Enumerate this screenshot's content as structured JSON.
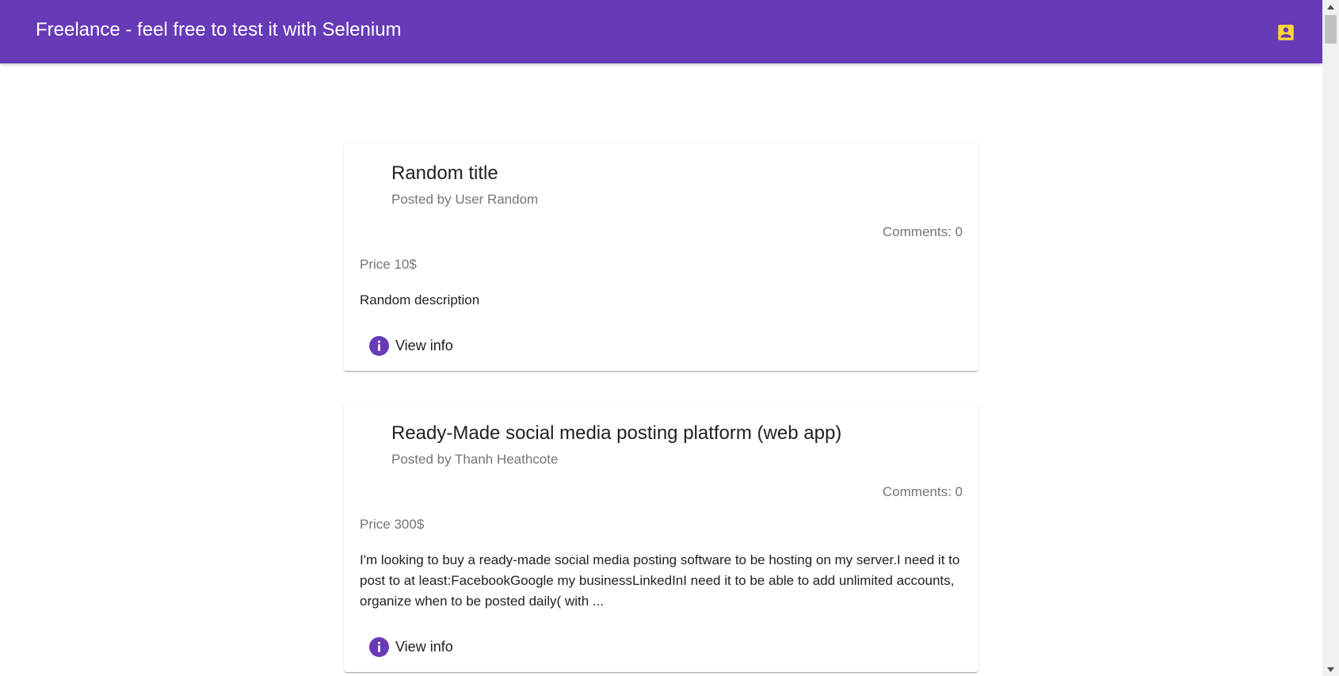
{
  "toolbar": {
    "title": "Freelance - feel free to test it with Selenium",
    "account_icon": "account-box-icon",
    "accent_color": "#673ab7",
    "icon_color": "#fdd835"
  },
  "jobs": [
    {
      "title": "Random title",
      "posted_by": "Posted by User Random",
      "comments": "Comments: 0",
      "price": "Price 10$",
      "description": "Random description",
      "action_label": "View info"
    },
    {
      "title": "Ready-Made social media posting platform (web app)",
      "posted_by": "Posted by Thanh Heathcote",
      "comments": "Comments: 0",
      "price": "Price 300$",
      "description": "I'm looking to buy a ready-made social media posting software to be hosting on my server.I need it to post to at least:FacebookGoogle my businessLinkedInI need it to be able to add unlimited accounts, organize when to be posted daily( with ...",
      "action_label": "View info"
    }
  ]
}
